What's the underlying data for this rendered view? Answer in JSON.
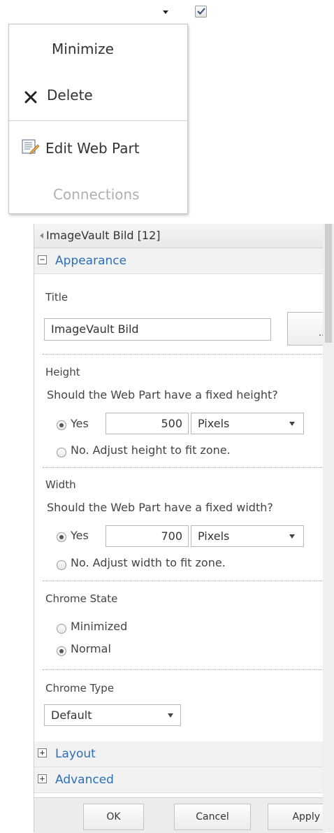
{
  "toolbar": {
    "menu_arrow": "chevron-down-icon",
    "select_checkbox_checked": true
  },
  "menu": {
    "minimize": "Minimize",
    "delete": "Delete",
    "edit_web_part": "Edit Web Part",
    "connections": "Connections"
  },
  "pane": {
    "title": "ImageVault Bild [12]",
    "appearance": {
      "header": "Appearance",
      "title_label": "Title",
      "title_value": "ImageVault Bild",
      "browse_button": "...",
      "height_label": "Height",
      "height_question": "Should the Web Part have a fixed height?",
      "height_yes": "Yes",
      "height_value": "500",
      "height_unit": "Pixels",
      "height_no": "No. Adjust height to fit zone.",
      "width_label": "Width",
      "width_question": "Should the Web Part have a fixed width?",
      "width_yes": "Yes",
      "width_value": "700",
      "width_unit": "Pixels",
      "width_no": "No. Adjust width to fit zone.",
      "chrome_state_label": "Chrome State",
      "chrome_state_minimized": "Minimized",
      "chrome_state_normal": "Normal",
      "chrome_type_label": "Chrome Type",
      "chrome_type_value": "Default"
    },
    "layout_header": "Layout",
    "advanced_header": "Advanced",
    "buttons": {
      "ok": "OK",
      "cancel": "Cancel",
      "apply": "Apply"
    }
  }
}
